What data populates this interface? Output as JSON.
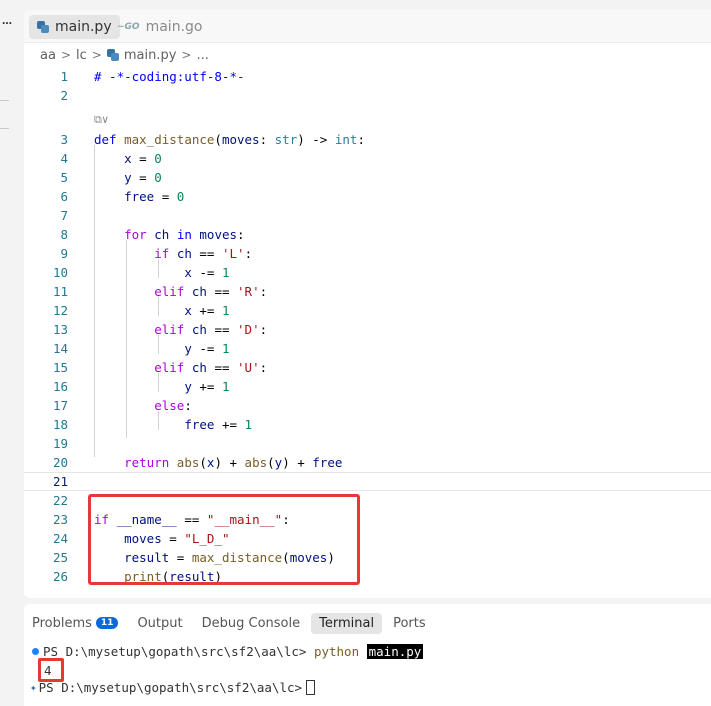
{
  "activity": {
    "more_icon": "…"
  },
  "tabs": [
    {
      "label": "main.py",
      "icon": "python-file-icon"
    },
    {
      "label": "main.go",
      "icon": "go-file-icon"
    }
  ],
  "breadcrumb": {
    "parts": [
      "aa",
      "lc",
      "main.py",
      "..."
    ],
    "separator": ">"
  },
  "editor": {
    "line_numbers": [
      "1",
      "2",
      "3",
      "4",
      "5",
      "6",
      "7",
      "8",
      "9",
      "10",
      "11",
      "12",
      "13",
      "14",
      "15",
      "16",
      "17",
      "18",
      "19",
      "20",
      "21",
      "22",
      "23",
      "24",
      "25",
      "26"
    ],
    "codelens": "⧉∨"
  },
  "terminal": {
    "tabs": [
      "Problems",
      "Output",
      "Debug Console",
      "Terminal",
      "Ports"
    ],
    "problems_count": "11",
    "prompt": "PS D:\\mysetup\\gopath\\src\\sf2\\aa\\lc>",
    "command": "python",
    "command_arg": "main.py",
    "output": "4"
  },
  "colors": {
    "accent": "#0969da",
    "highlight": "#e53935"
  }
}
